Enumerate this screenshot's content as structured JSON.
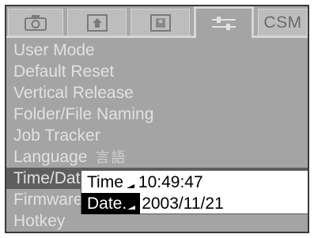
{
  "tabs": [
    {
      "icon": "camera-icon",
      "active": false
    },
    {
      "icon": "playback-icon",
      "active": false
    },
    {
      "icon": "print-icon",
      "active": false
    },
    {
      "icon": "setup-icon",
      "active": true
    },
    {
      "label": "CSM",
      "active": false
    }
  ],
  "menu": {
    "items": [
      {
        "label": "User Mode"
      },
      {
        "label": "Default Reset"
      },
      {
        "label": "Vertical Release"
      },
      {
        "label": "Folder/File Naming"
      },
      {
        "label": "Job Tracker"
      },
      {
        "label": "Language",
        "extra": "言語"
      },
      {
        "label": "Time/Date",
        "selected": true
      },
      {
        "label": "Firmware"
      },
      {
        "label": "Hotkey"
      }
    ]
  },
  "popup": {
    "time_label": "Time",
    "time_value": "10:49:47",
    "date_label": "Date.",
    "date_value": "2003/11/21"
  },
  "colors": {
    "screen_bg": "#a4a4a4",
    "menu_text": "#e1e1e1",
    "selected_bg": "#5e5e5e",
    "popup_bg": "#ffffff",
    "popup_highlight": "#000000"
  }
}
